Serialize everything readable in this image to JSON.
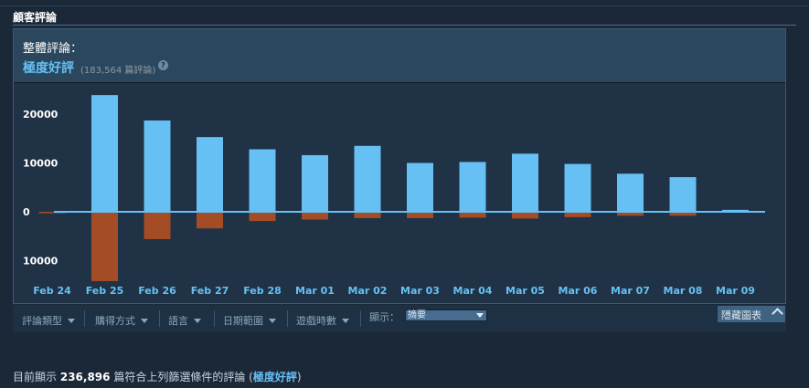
{
  "section": {
    "title": "顧客評論"
  },
  "summary": {
    "heading": "整體評論：",
    "rating": "極度好評",
    "count": "(183,564 篇評論)",
    "help": "?"
  },
  "colors": {
    "positive": "#66c0f4",
    "negative": "#a34c25",
    "zero_line": "#66c0f4",
    "axis_text": "#ffffff",
    "date_text": "#66c0f4"
  },
  "chart_data": {
    "type": "bar",
    "categories": [
      "Feb 24",
      "Feb 25",
      "Feb 26",
      "Feb 27",
      "Feb 28",
      "Mar 01",
      "Mar 02",
      "Mar 03",
      "Mar 04",
      "Mar 05",
      "Mar 06",
      "Mar 07",
      "Mar 08",
      "Mar 09"
    ],
    "series": [
      {
        "values": [
          0,
          23900,
          18700,
          15300,
          12800,
          11600,
          13500,
          10000,
          10200,
          11900,
          9800,
          7800,
          7100,
          400
        ]
      },
      {
        "values": [
          -300,
          -14200,
          -5600,
          -3400,
          -1900,
          -1600,
          -1300,
          -1300,
          -1200,
          -1400,
          -1100,
          -800,
          -800,
          0
        ]
      }
    ],
    "yticks": [
      20000,
      10000,
      0,
      -10000
    ],
    "ytick_labels": [
      "20000",
      "10000",
      "0",
      "10000"
    ],
    "ylim": [
      -14500,
      25000
    ],
    "grid": false
  },
  "filters": {
    "items": [
      "評論類型",
      "購得方式",
      "語言",
      "日期範圍",
      "遊戲時數"
    ],
    "display_label": "顯示：",
    "display_value": "摘要",
    "hide_chart": "隱藏圖表"
  },
  "footer": {
    "prefix": "目前顯示",
    "count": "236,896",
    "middle": "篇符合上列篩選條件的評論 (",
    "rating": "極度好評",
    "suffix": ")"
  }
}
